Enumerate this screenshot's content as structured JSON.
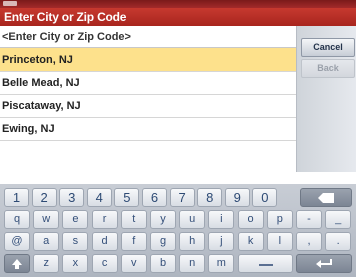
{
  "title": "Enter City or Zip Code",
  "input": {
    "value": "<Enter City or Zip Code>"
  },
  "results": [
    {
      "label": "Princeton, NJ",
      "selected": true
    },
    {
      "label": "Belle Mead, NJ",
      "selected": false
    },
    {
      "label": "Piscataway, NJ",
      "selected": false
    },
    {
      "label": "Ewing, NJ",
      "selected": false
    }
  ],
  "buttons": {
    "cancel": "Cancel",
    "back": "Back"
  },
  "keyboard": {
    "row1": [
      "1",
      "2",
      "3",
      "4",
      "5",
      "6",
      "7",
      "8",
      "9",
      "0"
    ],
    "row2": [
      "q",
      "w",
      "e",
      "r",
      "t",
      "y",
      "u",
      "i",
      "o",
      "p",
      "-",
      "_"
    ],
    "row3": [
      "@",
      "a",
      "s",
      "d",
      "f",
      "g",
      "h",
      "j",
      "k",
      "l",
      ",",
      "."
    ],
    "row4": [
      "z",
      "x",
      "c",
      "v",
      "b",
      "n",
      "m"
    ],
    "icons": {
      "backspace": "backspace-icon",
      "shift": "shift-icon",
      "space": "space-icon",
      "enter": "enter-icon"
    }
  },
  "colors": {
    "titlebar": "#b72c24",
    "selected_row": "#fde18c"
  }
}
